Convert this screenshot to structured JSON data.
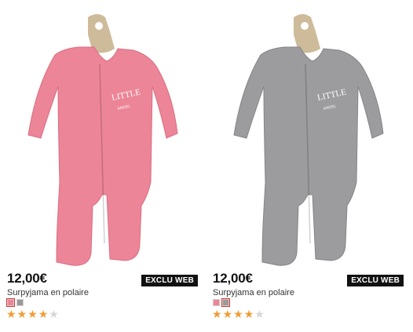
{
  "products": [
    {
      "price": "12,00€",
      "badge": "EXCLU WEB",
      "name": "Surpyjama en polaire",
      "print_text_1": "LITTLE",
      "print_text_2": "ANGEL",
      "garment_color": "#ec8597",
      "garment_shade": "#d96e82",
      "swatches": [
        {
          "color": "#ec8597",
          "selected": true
        },
        {
          "color": "#9a9a9a",
          "selected": false
        }
      ],
      "rating": 4,
      "rating_max": 5
    },
    {
      "price": "12,00€",
      "badge": "EXCLU WEB",
      "name": "Surpyjama en polaire",
      "print_text_1": "LITTLE",
      "print_text_2": "ANGEL",
      "garment_color": "#9c9c9e",
      "garment_shade": "#858587",
      "swatches": [
        {
          "color": "#ec8597",
          "selected": false
        },
        {
          "color": "#9a9a9a",
          "selected": true
        }
      ],
      "rating": 4,
      "rating_max": 5
    }
  ]
}
